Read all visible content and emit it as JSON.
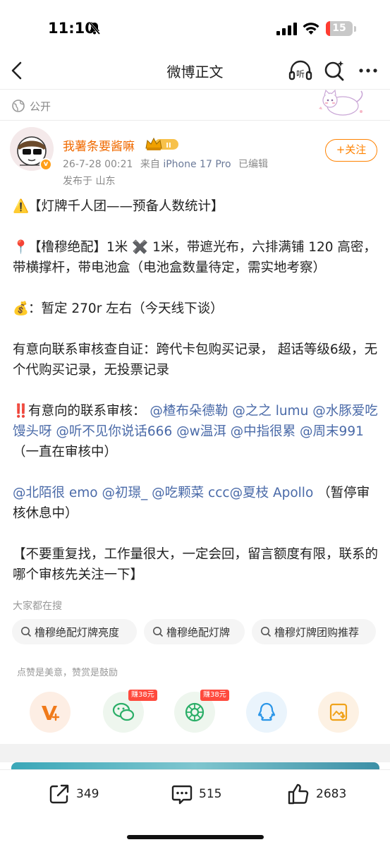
{
  "status_bar": {
    "time": "11:10",
    "battery": "15",
    "battery_level": 0.15
  },
  "nav": {
    "title": "微博正文",
    "listen_label": "听"
  },
  "visibility": "公开",
  "author": {
    "name": "我薯条要酱嘛",
    "crown_badge": "II",
    "date": "26-7-28 00:21",
    "source_prefix": "来自",
    "device": "iPhone 17 Pro",
    "edited": "已编辑",
    "location": "发布于 山东",
    "follow_label": "+关注"
  },
  "post": {
    "p1": {
      "emoji": "⚠️",
      "text": "【灯牌千人团——预备人数统计】"
    },
    "p2": {
      "emoji": "📍",
      "text": "【橹穆绝配】1米 ✖️ 1米，带遮光布，六排满铺 120 高密，带横撑杆，带电池盒（电池盒数量待定，需实地考察）"
    },
    "p3": {
      "emoji": "💰",
      "text": "：暂定 270r 左右（今天线下谈）"
    },
    "p4": {
      "text": "有意向联系审核查自证：跨代卡包购买记录， 超话等级6级，无个代购买记录，无投票记录"
    },
    "p5": {
      "emoji": "‼️",
      "lead": "有意向的联系审核：",
      "mentions": [
        "@楂布朵德勒",
        "@之之 lumu",
        "@水豚爱吃馒头呀",
        "@听不见你说话666",
        "@w温洱",
        "@中指很累",
        "@周末991"
      ],
      "tail": "（一直在审核中）"
    },
    "p6": {
      "mentions": [
        "@北陌很 emo",
        "@初璟_",
        "@吃颗菜 ccc",
        "@夏枝 Apollo"
      ],
      "tail": "（暂停审核休息中）"
    },
    "p7": {
      "text": "【不要重复找，工作量很大，一定会回，留言额度有限，联系的哪个审核先关注一下】"
    }
  },
  "search": {
    "heading": "大家都在搜",
    "chips": [
      "橹穆绝配灯牌亮度",
      "橹穆绝配灯牌",
      "橹穆灯牌团购推荐"
    ]
  },
  "share": {
    "hint": "点赞是美意，赞赏是鼓励",
    "reward_badge": "赚38元",
    "icons": [
      "v-plus-icon",
      "wechat-icon",
      "moments-icon",
      "qq-icon",
      "save-image-icon"
    ]
  },
  "actions": {
    "reposts": "349",
    "comments": "515",
    "likes": "2683"
  },
  "colors": {
    "accent": "#ff8200",
    "link": "#4a6aa8",
    "author": "#f06a00"
  }
}
